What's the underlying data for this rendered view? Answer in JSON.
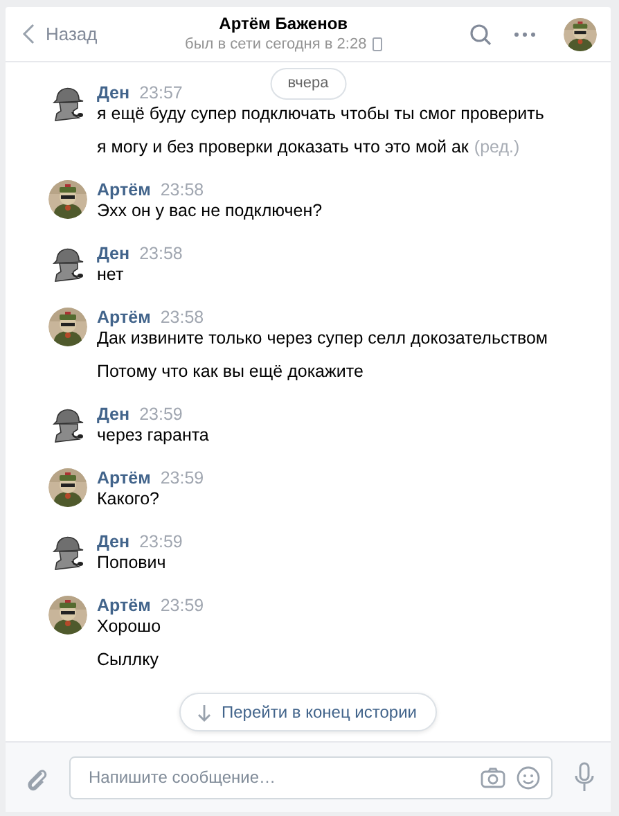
{
  "header": {
    "back_label": "Назад",
    "title": "Артём Баженов",
    "status": "был в сети сегодня в 2:28",
    "mobile": true
  },
  "date_label": "вчера",
  "messages": [
    {
      "author": "Ден",
      "kind": "drawing",
      "time": "23:57",
      "lines": [
        {
          "text": "я ещё буду супер подключать чтобы ты смог проверить"
        },
        {
          "text": "я могу и без проверки доказать что это мой ак",
          "edited": "(ред.)"
        }
      ]
    },
    {
      "author": "Артём",
      "time": "23:58",
      "lines": [
        {
          "text": "Эхх он у вас не подключен?"
        }
      ]
    },
    {
      "author": "Ден",
      "kind": "drawing",
      "time": "23:58",
      "lines": [
        {
          "text": "нет"
        }
      ]
    },
    {
      "author": "Артём",
      "time": "23:58",
      "lines": [
        {
          "text": "Дак извините только через супер селл докозательством"
        },
        {
          "text": "Потому что как вы ещё докажите"
        }
      ]
    },
    {
      "author": "Ден",
      "kind": "drawing",
      "time": "23:59",
      "lines": [
        {
          "text": "через гаранта"
        }
      ]
    },
    {
      "author": "Артём",
      "time": "23:59",
      "lines": [
        {
          "text": "Какого?"
        }
      ]
    },
    {
      "author": "Ден",
      "kind": "drawing",
      "time": "23:59",
      "lines": [
        {
          "text": "Попович"
        }
      ]
    },
    {
      "author": "Артём",
      "time": "23:59",
      "lines": [
        {
          "text": "Хорошо"
        },
        {
          "text": "Сыллку"
        }
      ]
    }
  ],
  "jump_button": "Перейти в конец истории",
  "composer": {
    "placeholder": "Напишите сообщение…"
  }
}
